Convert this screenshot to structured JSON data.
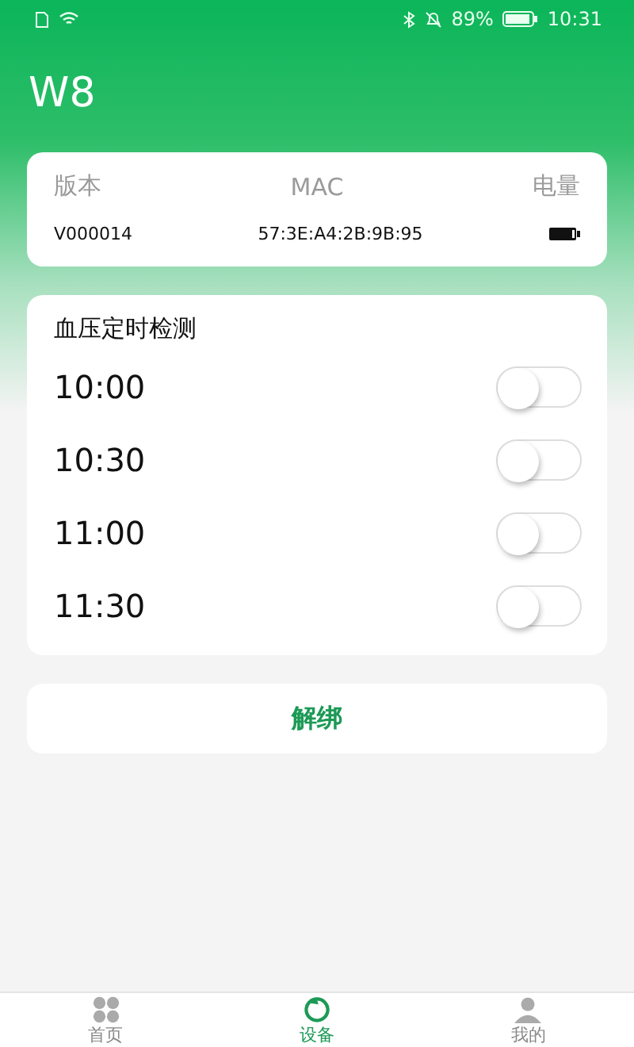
{
  "status_bar": {
    "battery": "89%",
    "time": "10:31"
  },
  "title": "W8",
  "device_info": {
    "headers": [
      "版本",
      "MAC",
      "电量"
    ],
    "version": "V000014",
    "mac": "57:3E:A4:2B:9B:95"
  },
  "schedule": {
    "title": "血压定时检测",
    "items": [
      {
        "time": "10:00",
        "on": false
      },
      {
        "time": "10:30",
        "on": false
      },
      {
        "time": "11:00",
        "on": false
      },
      {
        "time": "11:30",
        "on": false
      }
    ]
  },
  "unbind_button": "解绑",
  "tabs": [
    {
      "label": "首页",
      "kind": "home",
      "selected": false
    },
    {
      "label": "设备",
      "kind": "device",
      "selected": true
    },
    {
      "label": "我的",
      "kind": "profile",
      "selected": false
    }
  ]
}
